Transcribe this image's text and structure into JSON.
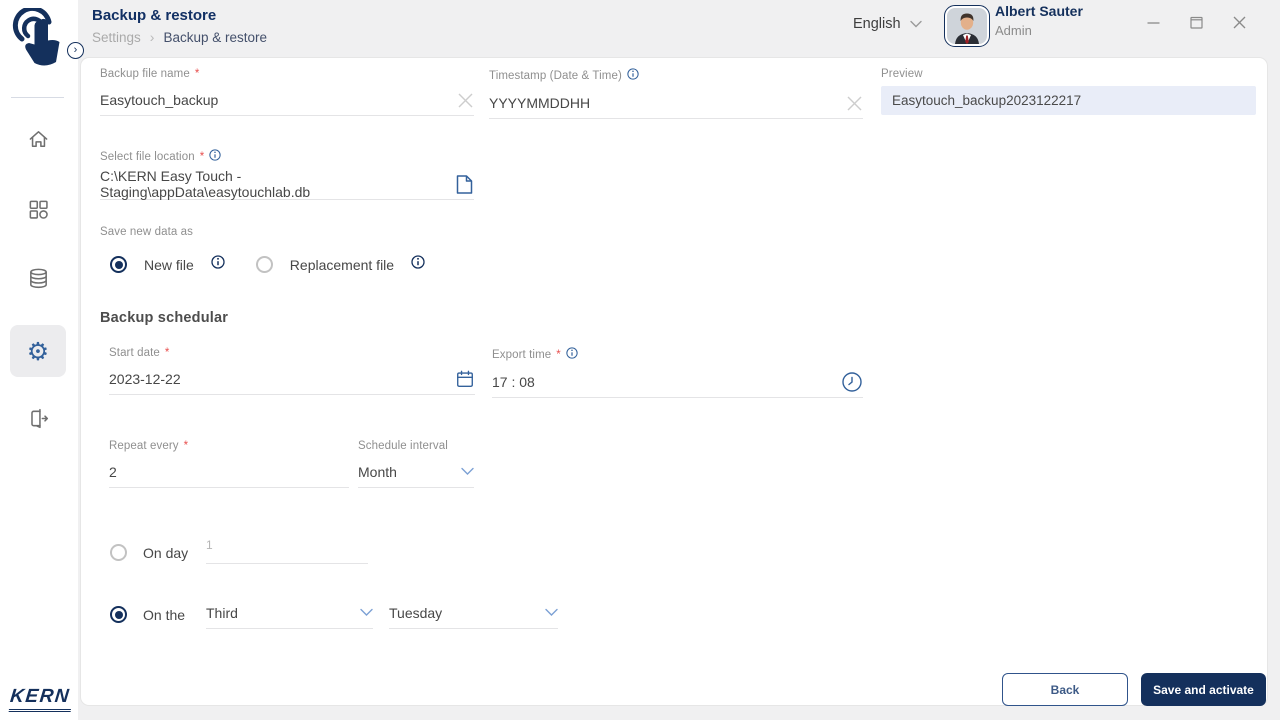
{
  "header": {
    "title": "Backup & restore",
    "breadcrumb": {
      "parent": "Settings",
      "separator": "›",
      "current": "Backup & restore"
    },
    "language": "English",
    "user": {
      "name": "Albert Sauter",
      "role": "Admin"
    }
  },
  "sidebar": {
    "brand": "KERN",
    "expand_glyph": "›"
  },
  "form": {
    "required_marker": "*",
    "backup_file_name": {
      "label": "Backup file name",
      "value": "Easytouch_backup"
    },
    "timestamp": {
      "label": "Timestamp (Date & Time)",
      "value": "YYYYMMDDHH"
    },
    "preview": {
      "label": "Preview",
      "value": "Easytouch_backup2023122217"
    },
    "file_location": {
      "label": "Select file location",
      "value": "C:\\KERN Easy Touch - Staging\\appData\\easytouchlab.db"
    },
    "save_new_data_as": {
      "label": "Save new data as",
      "option_new": "New file",
      "option_replacement": "Replacement file"
    },
    "scheduler": {
      "heading": "Backup schedular",
      "start_date": {
        "label": "Start date",
        "value": "2023-12-22"
      },
      "export_time": {
        "label": "Export time",
        "value": "17 : 08"
      },
      "repeat_every": {
        "label": "Repeat every",
        "value": "2"
      },
      "schedule_interval": {
        "label": "Schedule interval",
        "value": "Month"
      },
      "on_day": {
        "label": "On day",
        "value": "1"
      },
      "on_the": {
        "label": "On the",
        "ordinal": "Third",
        "weekday": "Tuesday"
      }
    }
  },
  "buttons": {
    "back": "Back",
    "save": "Save and activate"
  },
  "colors": {
    "navy": "#14305c",
    "info_blue": "#33619b",
    "required_red": "#e8504f",
    "preview_bg": "#e9edf8"
  }
}
